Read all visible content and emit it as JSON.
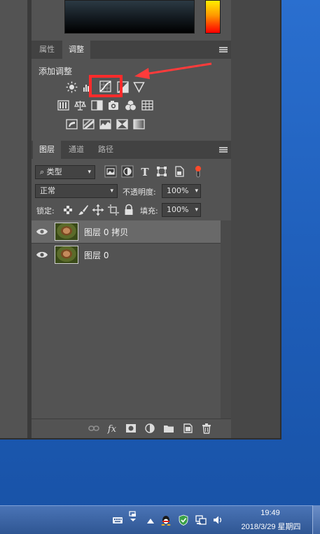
{
  "adjustments_panel": {
    "tab_properties": "属性",
    "tab_adjustments": "调整",
    "add_adjustment_label": "添加调整"
  },
  "layers_panel": {
    "tab_layers": "图层",
    "tab_channels": "通道",
    "tab_paths": "路径",
    "filter_kind": "类型",
    "blend_mode": "正常",
    "opacity_label": "不透明度:",
    "opacity_value": "100%",
    "lock_label": "锁定:",
    "fill_label": "填充:",
    "fill_value": "100%",
    "layers": [
      {
        "name": "图层 0 拷贝",
        "selected": true,
        "visible": true
      },
      {
        "name": "图层 0",
        "selected": false,
        "visible": true
      }
    ],
    "bottom_icons": [
      "link-icon",
      "fx-icon",
      "mask-icon",
      "adjustment-layer-icon",
      "group-folder-icon",
      "new-layer-icon",
      "trash-icon"
    ]
  },
  "highlight": {
    "color": "#ff2b2b",
    "target": "curves-adjustment-icon"
  },
  "taskbar": {
    "time": "19:49",
    "date": "2018/3/29 星期四"
  },
  "colors": {
    "panel_bg": "#535353",
    "selected_layer": "#696969",
    "desktop": "#1e5db8",
    "accent_red": "#ff2b2b"
  }
}
